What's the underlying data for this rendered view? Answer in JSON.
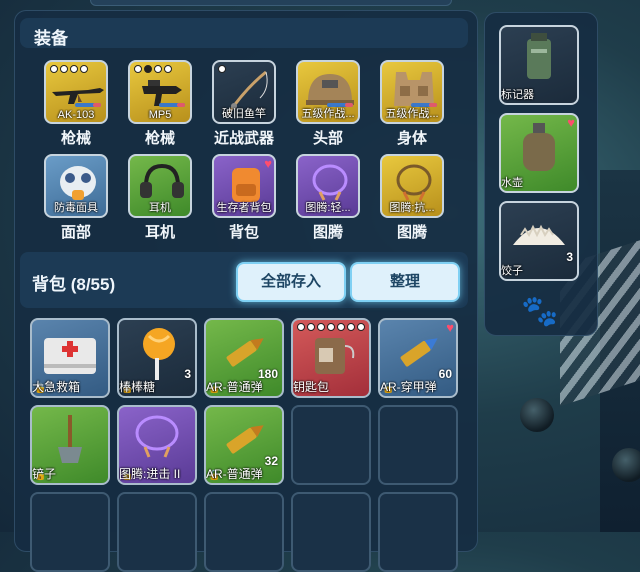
{
  "equipment": {
    "title": "装备",
    "items": [
      {
        "name": "AK-103",
        "category": "枪械",
        "icon": "rifle-icon"
      },
      {
        "name": "MP5",
        "category": "枪械",
        "icon": "smg-icon"
      },
      {
        "name": "破旧鱼竿",
        "category": "近战武器",
        "icon": "fishing-rod-icon"
      },
      {
        "name": "五级作战...",
        "category": "头部",
        "icon": "helmet-icon"
      },
      {
        "name": "五级作战...",
        "category": "身体",
        "icon": "vest-icon"
      },
      {
        "name": "防毒面具",
        "category": "面部",
        "icon": "gas-mask-icon"
      },
      {
        "name": "耳机",
        "category": "耳机",
        "icon": "headset-icon"
      },
      {
        "name": "生存者背包",
        "category": "背包",
        "icon": "backpack-icon"
      },
      {
        "name": "图腾:轻...",
        "category": "图腾",
        "icon": "totem-necklace-icon"
      },
      {
        "name": "图腾:抗...",
        "category": "图腾",
        "icon": "totem-necklace-icon"
      }
    ]
  },
  "backpack": {
    "title": "背包 (8/55)",
    "deposit_all_label": "全部存入",
    "sort_label": "整理",
    "items": [
      {
        "name": "大急救箱",
        "count": "",
        "icon": "first-aid-kit-icon"
      },
      {
        "name": "棒棒糖",
        "count": "3",
        "icon": "lollipop-icon"
      },
      {
        "name": "AR-普通弹",
        "count": "180",
        "icon": "bullet-icon"
      },
      {
        "name": "钥匙包",
        "count": "",
        "icon": "key-pouch-icon"
      },
      {
        "name": "AR-穿甲弹",
        "count": "60",
        "icon": "bullet-icon"
      },
      {
        "name": "铲子",
        "count": "",
        "icon": "shovel-icon"
      },
      {
        "name": "图腾:进击 II",
        "count": "",
        "icon": "totem-necklace-icon"
      },
      {
        "name": "AR-普通弹",
        "count": "32",
        "icon": "bullet-icon"
      }
    ]
  },
  "quick_slots": [
    {
      "name": "标记器",
      "count": "",
      "icon": "marker-device-icon"
    },
    {
      "name": "水壶",
      "count": "",
      "icon": "canteen-icon"
    },
    {
      "name": "饺子",
      "count": "3",
      "icon": "dumpling-icon"
    }
  ],
  "pet_icon": "paw-icon"
}
